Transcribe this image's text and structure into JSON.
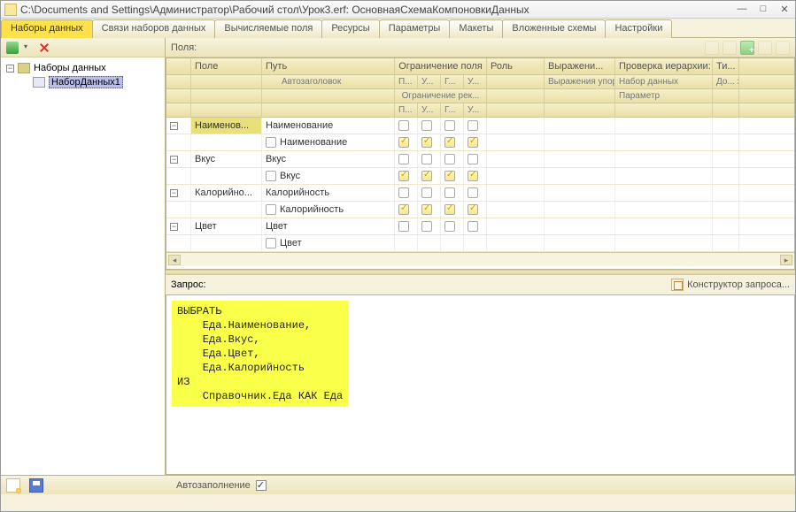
{
  "window": {
    "title": "C:\\Documents and Settings\\Администратор\\Рабочий стол\\Урок3.erf: ОсновнаяСхемаКомпоновкиДанных"
  },
  "tabs": [
    {
      "label": "Наборы данных",
      "active": true
    },
    {
      "label": "Связи наборов данных"
    },
    {
      "label": "Вычисляемые поля"
    },
    {
      "label": "Ресурсы"
    },
    {
      "label": "Параметры"
    },
    {
      "label": "Макеты"
    },
    {
      "label": "Вложенные схемы"
    },
    {
      "label": "Настройки"
    }
  ],
  "tree": {
    "root_label": "Наборы данных",
    "items": [
      {
        "label": "НаборДанных1",
        "selected": true
      }
    ]
  },
  "fields_header": "Поля:",
  "grid": {
    "head1": {
      "field": "Поле",
      "path": "Путь",
      "restriction_field": "Ограничение поля",
      "role": "Роль",
      "expression": "Выражени...",
      "hierarchy": "Проверка иерархии:",
      "ti": "Ти..."
    },
    "head2": {
      "autoheader": "Автозаголовок",
      "ord_expression": "Выражения упорядочив...",
      "dataset": "Набор данных",
      "do": "До... зна..."
    },
    "head3": {
      "restriction_rec": "Ограничение рек...",
      "c1": "П...",
      "c2": "У...",
      "c3": "Г...",
      "c4": "У...",
      "parameter": "Параметр"
    },
    "rows": [
      {
        "field": "Наименов...",
        "path": "Наименование",
        "autohdr": "Наименование",
        "selected": true,
        "checks1": [
          false,
          false,
          false,
          false
        ],
        "checks2": [
          true,
          true,
          true,
          true
        ]
      },
      {
        "field": "Вкус",
        "path": "Вкус",
        "autohdr": "Вкус",
        "checks1": [
          false,
          false,
          false,
          false
        ],
        "checks2": [
          true,
          true,
          true,
          true
        ]
      },
      {
        "field": "Калорийно...",
        "path": "Калорийность",
        "autohdr": "Калорийность",
        "checks1": [
          false,
          false,
          false,
          false
        ],
        "checks2": [
          true,
          true,
          true,
          true
        ]
      },
      {
        "field": "Цвет",
        "path": "Цвет",
        "autohdr": "Цвет",
        "checks1": [
          false,
          false,
          false,
          false
        ],
        "checks2": [
          true,
          true,
          true,
          true
        ]
      }
    ]
  },
  "query": {
    "label": "Запрос:",
    "builder_label": "Конструктор запроса...",
    "text": "ВЫБРАТЬ\n    Еда.Наименование,\n    Еда.Вкус,\n    Еда.Цвет,\n    Еда.Калорийность\nИЗ\n    Справочник.Еда КАК Еда"
  },
  "footer": {
    "autofill_label": "Автозаполнение",
    "autofill_checked": true
  }
}
